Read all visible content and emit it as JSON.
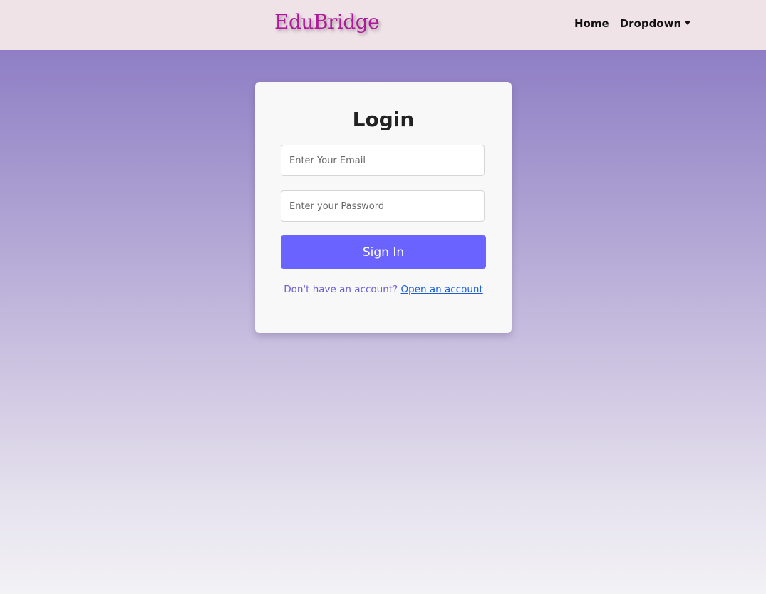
{
  "navbar": {
    "brand": "EduBridge",
    "links": {
      "home": "Home",
      "dropdown": "Dropdown"
    }
  },
  "login": {
    "title": "Login",
    "email_placeholder": "Enter Your Email",
    "password_placeholder": "Enter your Password",
    "submit_label": "Sign In",
    "no_account_text": "Don't have an account?",
    "open_account_link": "Open an account"
  },
  "colors": {
    "brand": "#b0189b",
    "primary_button": "#6b63ff",
    "navbar_bg": "#efe3e8",
    "link": "#1a5fd8",
    "muted_text": "#6a5ed0"
  },
  "icons": {
    "dropdown_caret": "caret-down-icon"
  }
}
